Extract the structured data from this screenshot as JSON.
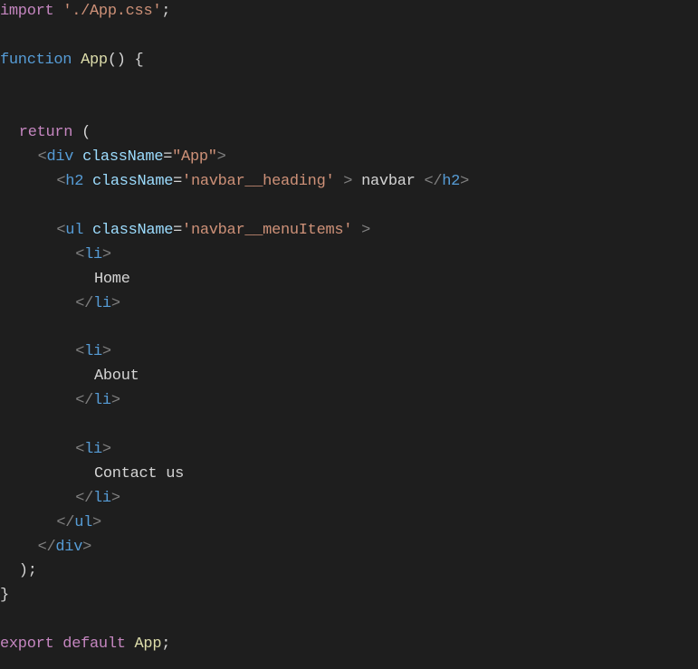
{
  "code": {
    "line1": {
      "import_kw": "import",
      "space": " ",
      "path": "'./App.css'",
      "semi": ";"
    },
    "line3": {
      "function_kw": "function",
      "space": " ",
      "name": "App",
      "rest": "() {"
    },
    "line6": {
      "return_kw": "return",
      "rest": " ("
    },
    "line7": {
      "lt": "<",
      "tag": "div",
      "space": " ",
      "attr": "className",
      "eq": "=",
      "val": "\"App\"",
      "gt": ">"
    },
    "line8": {
      "lt": "<",
      "tag": "h2",
      "space": " ",
      "attr": "className",
      "eq": "=",
      "val": "'navbar__heading'",
      "gt1": " > ",
      "text": "navbar",
      "space2": " ",
      "lt2": "</",
      "tag2": "h2",
      "gt2": ">"
    },
    "line10": {
      "lt": "<",
      "tag": "ul",
      "space": " ",
      "attr": "className",
      "eq": "=",
      "val": "'navbar__menuItems'",
      "gt": " >"
    },
    "li_open": {
      "lt": "<",
      "tag": "li",
      "gt": ">"
    },
    "li_close": {
      "lt": "</",
      "tag": "li",
      "gt": ">"
    },
    "item_home": "Home",
    "item_about": "About",
    "item_contact": "Contact us",
    "line22": {
      "lt": "</",
      "tag": "ul",
      "gt": ">"
    },
    "line23": {
      "lt": "</",
      "tag": "div",
      "gt": ">"
    },
    "line24": {
      "text": ");"
    },
    "line25": {
      "text": "}"
    },
    "line27": {
      "export_kw": "export default",
      "space": " ",
      "name": "App",
      "semi": ";"
    }
  },
  "colors": {
    "background": "#1e1e1e",
    "keyword": "#c586c0",
    "string": "#ce9178",
    "function": "#dcdcaa",
    "declaration": "#569cd6",
    "tag": "#569cd6",
    "tag_punctuation": "#808080",
    "attribute": "#9cdcfe",
    "text": "#d4d4d4"
  }
}
